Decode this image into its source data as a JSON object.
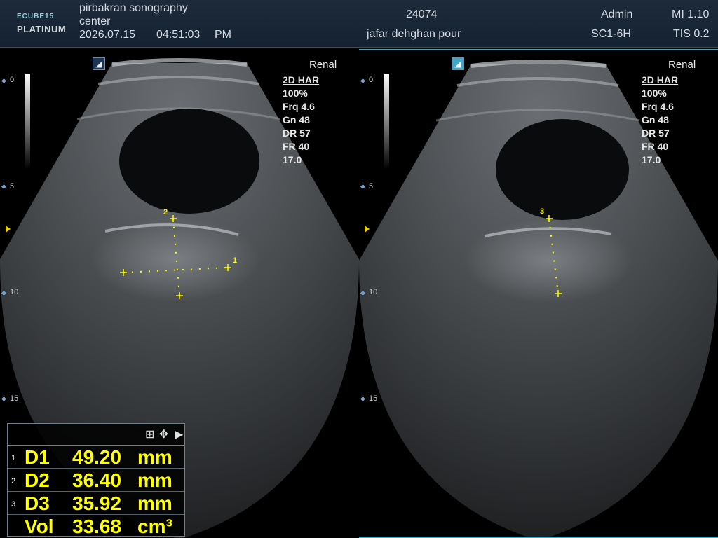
{
  "header": {
    "logo_top": "ECUBE",
    "logo_top_suffix": "15",
    "logo_bottom": "PLATINUM",
    "institution_line1": "pirbakran sonography",
    "institution_line2": "center",
    "date": "2026.07.15",
    "time": "04:51:03",
    "ampm": "PM",
    "patient_id": "24074",
    "patient_name": "jafar dehghan pour",
    "operator": "Admin",
    "probe": "SC1-6H",
    "mi": "MI 1.10",
    "tis": "TIS 0.2"
  },
  "left_image": {
    "preset": "Renal",
    "mode": "2D HAR",
    "power": "100%",
    "freq": "Frq 4.6",
    "gain": "Gn 48",
    "dr": "DR 57",
    "fr": "FR 40",
    "depth": "17.0",
    "orientation_icon": "probe-orientation-icon",
    "depth_labels": [
      "0",
      "5",
      "10",
      "15"
    ],
    "markers": [
      "1",
      "2"
    ]
  },
  "right_image": {
    "preset": "Renal",
    "mode": "2D HAR",
    "power": "100%",
    "freq": "Frq 4.6",
    "gain": "Gn 48",
    "dr": "DR 57",
    "fr": "FR 40",
    "depth": "17.0",
    "orientation_icon": "probe-orientation-icon",
    "depth_labels": [
      "0",
      "5",
      "10",
      "15"
    ],
    "markers": [
      "3"
    ]
  },
  "measurements": {
    "tool_icons": [
      "layout-icon",
      "move-icon",
      "expand-arrow-icon"
    ],
    "rows": [
      {
        "index": "1",
        "name": "D1",
        "value": "49.20",
        "unit": "mm"
      },
      {
        "index": "2",
        "name": "D2",
        "value": "36.40",
        "unit": "mm"
      },
      {
        "index": "3",
        "name": "D3",
        "value": "35.92",
        "unit": "mm"
      },
      {
        "index": "",
        "name": "Vol",
        "value": "33.68",
        "unit": "cm³"
      }
    ]
  },
  "colors": {
    "accent": "#3fa8c4",
    "caliper": "#ffff00",
    "header_bg": "#1c2a3a"
  }
}
